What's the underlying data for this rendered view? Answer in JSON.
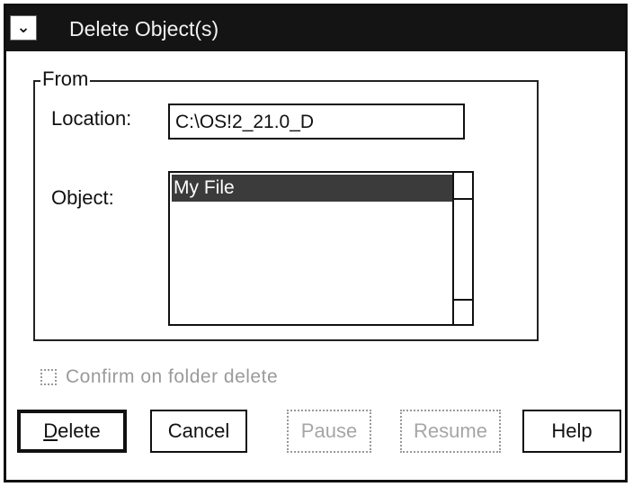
{
  "window": {
    "title": "Delete Object(s)",
    "system_menu_icon": "system-menu-icon"
  },
  "from_group": {
    "label": "From",
    "location_label": "Location:",
    "location_value": "C:\\OS!2_21.0_D",
    "object_label": "Object:",
    "objects": [
      "My File"
    ],
    "selected_object": "My File"
  },
  "checkbox": {
    "label": "Confirm on folder delete",
    "checked": false,
    "enabled": false
  },
  "buttons": {
    "delete": {
      "first": "D",
      "rest": "elete"
    },
    "cancel": "Cancel",
    "pause": "Pause",
    "resume": "Resume",
    "help": "Help"
  },
  "colors": {
    "titlebar": "#141414",
    "selection": "#3b3b3b",
    "disabled_text": "#a6a6a6"
  }
}
